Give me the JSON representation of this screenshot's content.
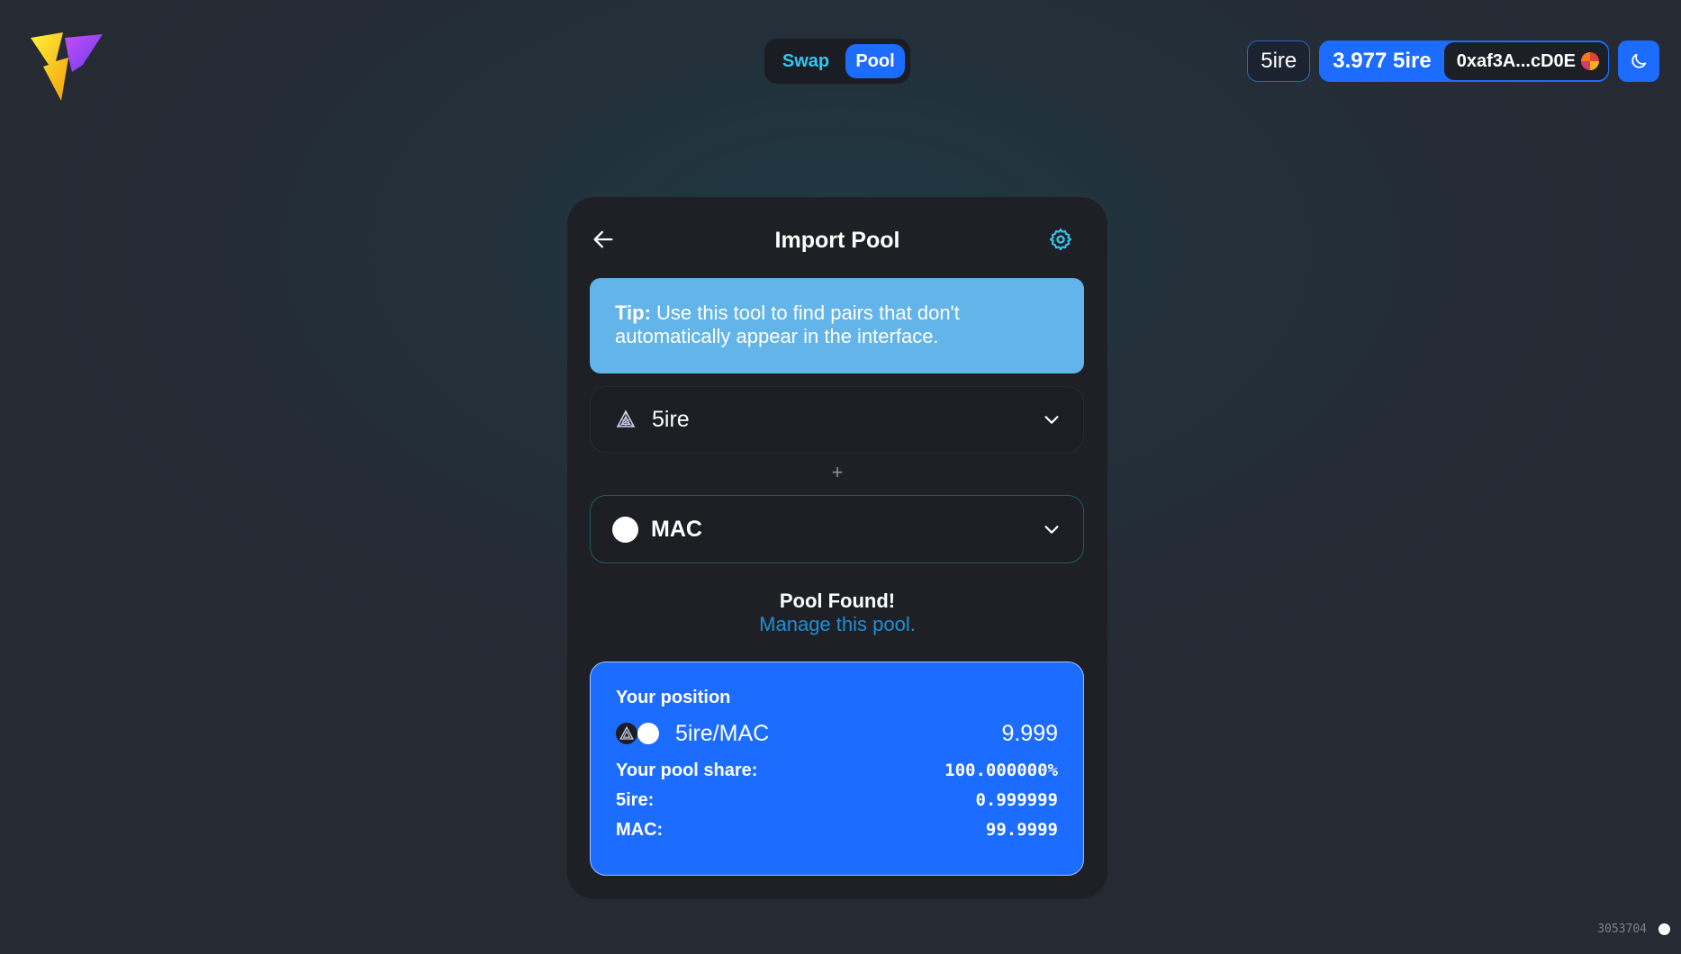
{
  "header": {
    "logo_icon": "lightning-logo-icon",
    "nav": {
      "swap_label": "Swap",
      "pool_label": "Pool",
      "active": "Pool"
    },
    "network_label": "5ire",
    "balance": "3.977 5ire",
    "address": "0xaf3A...cD0E",
    "theme_icon": "moon-icon"
  },
  "card": {
    "title": "Import Pool",
    "tip_bold": "Tip:",
    "tip_text": " Use this tool to find pairs that don't automatically appear in the interface.",
    "token_a": {
      "name": "5ire",
      "icon": "5ire-token-icon"
    },
    "plus": "+",
    "token_b": {
      "name": "MAC",
      "icon": "mac-token-icon"
    },
    "pool_found": "Pool Found!",
    "manage_link": "Manage this pool."
  },
  "position": {
    "label": "Your position",
    "pair": "5ire/MAC",
    "pair_value": "9.999",
    "rows": [
      {
        "label": "Your pool share:",
        "value": "100.000000%"
      },
      {
        "label": "5ire:",
        "value": "0.999999"
      },
      {
        "label": "MAC:",
        "value": "99.9999"
      }
    ]
  },
  "footer": {
    "build": "3053704"
  },
  "colors": {
    "accent": "#1b6cff",
    "tip_bg": "#63b4e8",
    "link": "#1e8fd6",
    "swap_text": "#2fc9f2"
  }
}
